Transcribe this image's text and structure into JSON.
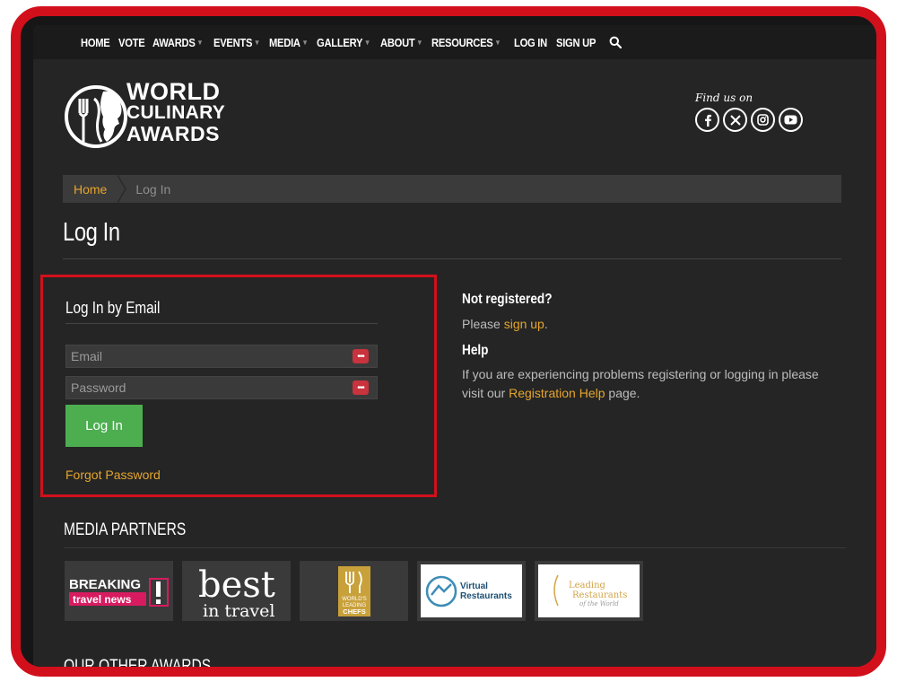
{
  "nav": {
    "items": [
      {
        "label": "HOME",
        "dropdown": false
      },
      {
        "label": "VOTE",
        "dropdown": false
      },
      {
        "label": "AWARDS",
        "dropdown": true
      },
      {
        "label": "EVENTS",
        "dropdown": true
      },
      {
        "label": "MEDIA",
        "dropdown": true
      },
      {
        "label": "GALLERY",
        "dropdown": true
      },
      {
        "label": "ABOUT",
        "dropdown": true
      },
      {
        "label": "RESOURCES",
        "dropdown": true
      },
      {
        "label": "LOG IN",
        "dropdown": false
      },
      {
        "label": "SIGN UP",
        "dropdown": false
      }
    ],
    "search_icon": "search-icon"
  },
  "logo": {
    "line1": "WORLD",
    "line2": "CULINARY",
    "line3": "AWARDS"
  },
  "social": {
    "label": "Find us on",
    "icons": [
      "facebook-icon",
      "x-icon",
      "instagram-icon",
      "youtube-icon"
    ]
  },
  "breadcrumb": {
    "home": "Home",
    "current": "Log In"
  },
  "page_title": "Log In",
  "login": {
    "heading": "Log In by Email",
    "email_placeholder": "Email",
    "password_placeholder": "Password",
    "button_label": "Log In",
    "forgot_label": "Forgot Password"
  },
  "side": {
    "not_registered_heading": "Not registered?",
    "please": "Please",
    "signup_link": "sign up",
    "period": ".",
    "help_heading": "Help",
    "help_text": "If you are experiencing problems registering or logging in please visit our",
    "help_link": "Registration Help",
    "help_tail": "page."
  },
  "media_partners": {
    "title": "MEDIA PARTNERS",
    "logos": {
      "breaking_1": "BREAKING",
      "breaking_2": "travel news",
      "best_1": "best",
      "best_2": "in travel",
      "chefs_1": "WORLD'S",
      "chefs_2": "LEADING",
      "chefs_3": "CHEFS",
      "virtual_1": "Virtual",
      "virtual_2": "Restaurants",
      "leading_1": "Leading",
      "leading_2": "Restaurants",
      "leading_3": "of the World"
    }
  },
  "other_awards": {
    "title": "OUR OTHER AWARDS"
  },
  "colors": {
    "accent_gold": "#e5a52d",
    "button_green": "#4cae4f",
    "highlight_red": "#d1101c",
    "page_bg": "#252525"
  }
}
